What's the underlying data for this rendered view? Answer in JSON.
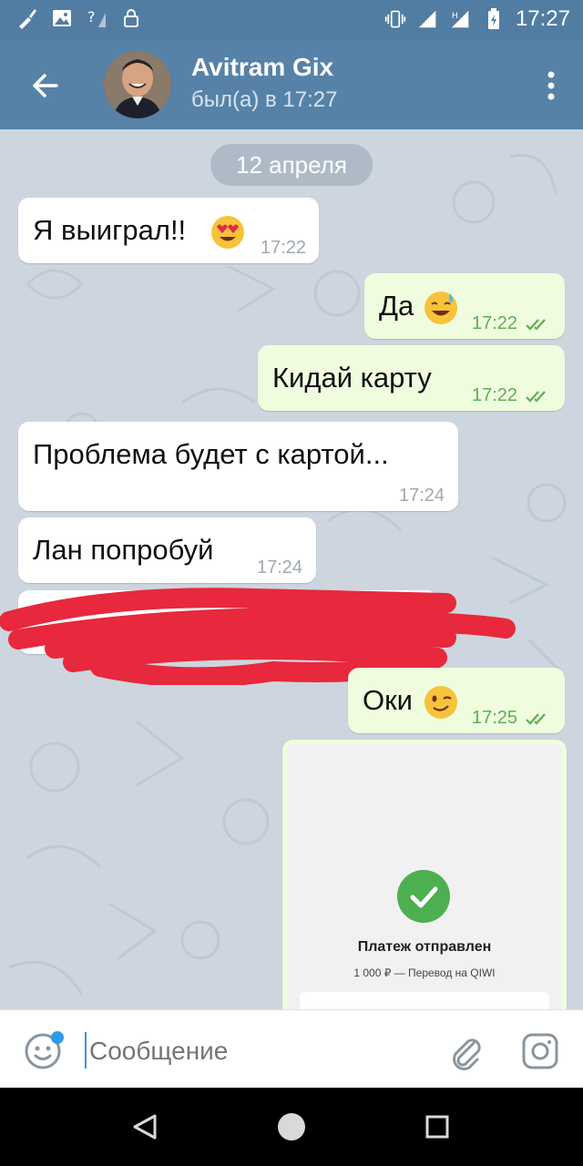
{
  "status_bar": {
    "time": "17:27"
  },
  "header": {
    "contact_name": "Avitram Gix",
    "last_seen": "был(а) в 17:27"
  },
  "chat": {
    "date_separator": "12 апреля",
    "messages": [
      {
        "direction": "in",
        "text": "Я выиграл!!",
        "emoji": "heart-eyes-emoji",
        "time": "17:22"
      },
      {
        "direction": "out",
        "text": "Да",
        "emoji": "sweat-smile-emoji",
        "time": "17:22",
        "read": true
      },
      {
        "direction": "out",
        "text": "Кидай карту",
        "time": "17:22",
        "read": true
      },
      {
        "direction": "in",
        "text": "Проблема будет с картой...",
        "time": "17:24"
      },
      {
        "direction": "in",
        "text": "Лан попробуй",
        "time": "17:24"
      },
      {
        "direction": "in",
        "text": "",
        "redacted": true
      },
      {
        "direction": "out",
        "text": "Оки",
        "emoji": "wink-emoji",
        "time": "17:25",
        "read": true
      }
    ],
    "payment_image": {
      "title": "Платеж отправлен",
      "subtitle": "1 000 ₽ — Перевод на QIWI",
      "status_color": "#4caf50"
    }
  },
  "input": {
    "placeholder": "Сообщение"
  },
  "colors": {
    "header": "#5682a8",
    "status_bar": "#527da3",
    "outgoing": "#effdde",
    "incoming": "#ffffff",
    "read_ticks": "#5fae53",
    "redaction": "#e8283c"
  }
}
